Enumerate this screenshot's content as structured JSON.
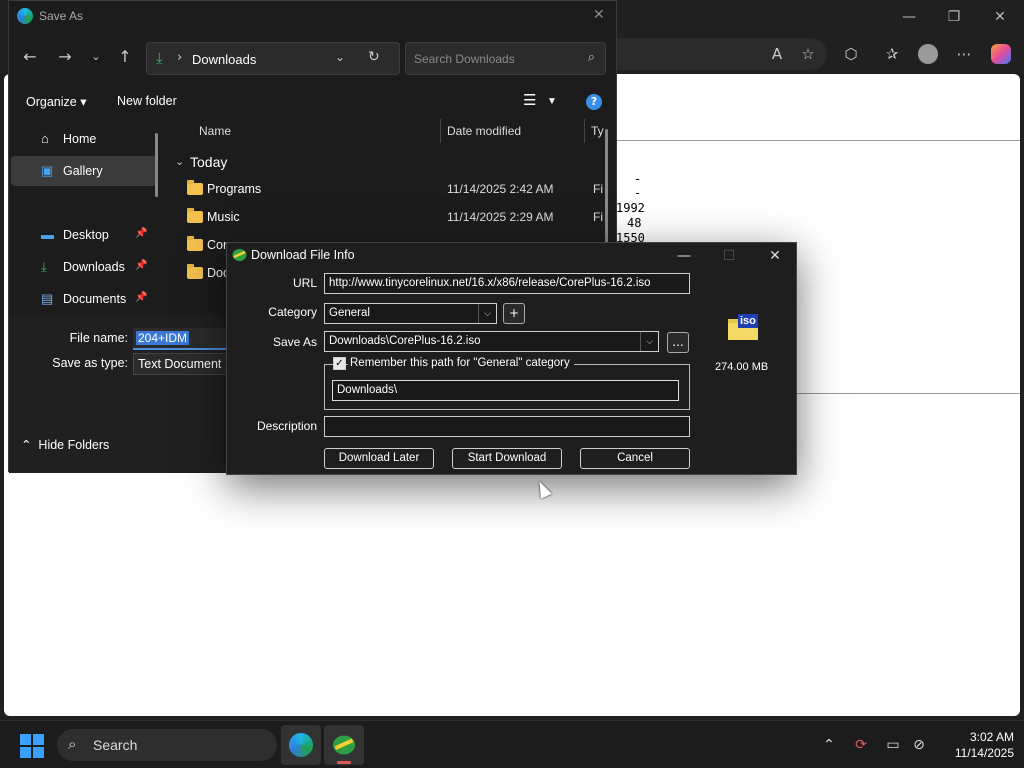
{
  "browser": {
    "window_controls": {
      "minimize": "—",
      "restore": "❐",
      "close": "✕"
    },
    "page_numbers": [
      "-",
      "-",
      "1992",
      "48",
      "1550"
    ]
  },
  "save_as": {
    "title": "Save As",
    "address": {
      "path": "Downloads"
    },
    "search_placeholder": "Search Downloads",
    "commands": {
      "organize": "Organize",
      "new_folder": "New folder"
    },
    "nav": [
      {
        "label": "Home",
        "icon": "home-icon"
      },
      {
        "label": "Gallery",
        "icon": "gallery-icon",
        "selected": true
      },
      {
        "label": "Desktop",
        "icon": "desktop-icon",
        "pinned": true
      },
      {
        "label": "Downloads",
        "icon": "download-icon",
        "pinned": true
      },
      {
        "label": "Documents",
        "icon": "documents-icon",
        "pinned": true
      }
    ],
    "columns": {
      "name": "Name",
      "date": "Date modified",
      "type": "Ty"
    },
    "group": "Today",
    "files": [
      {
        "name": "Programs",
        "date": "11/14/2025 2:42 AM",
        "type": "Fi"
      },
      {
        "name": "Music",
        "date": "11/14/2025 2:29 AM",
        "type": "Fi"
      },
      {
        "name": "Com",
        "date": "",
        "type": ""
      },
      {
        "name": "Doc",
        "date": "",
        "type": ""
      }
    ],
    "file_name_label": "File name:",
    "file_name_value": "204+IDM",
    "save_type_label": "Save as type:",
    "save_type_value": "Text Document",
    "hide_folders": "Hide Folders"
  },
  "dfi": {
    "title": "Download File Info",
    "url_label": "URL",
    "url": "http://www.tinycorelinux.net/16.x/x86/release/CorePlus-16.2.iso",
    "category_label": "Category",
    "category": "General",
    "add_label": "+",
    "save_as_label": "Save As",
    "save_as": "Downloads\\CorePlus-16.2.iso",
    "browse_label": "...",
    "remember_label": "Remember this path for \"General\" category",
    "remember_checked": true,
    "path": "Downloads\\",
    "description_label": "Description",
    "description": "",
    "file_type_badge": "iso",
    "size": "274.00  MB",
    "buttons": {
      "later": "Download Later",
      "start": "Start Download",
      "cancel": "Cancel"
    }
  },
  "taskbar": {
    "search": "Search",
    "time": "3:02 AM",
    "date": "11/14/2025"
  }
}
